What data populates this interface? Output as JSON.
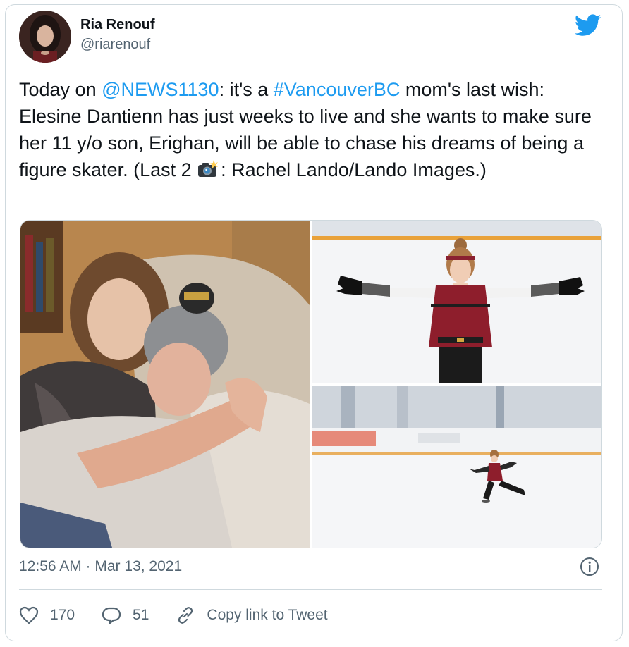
{
  "author": {
    "name": "Ria Renouf",
    "handle": "@riarenouf"
  },
  "tweet": {
    "text_1": "Today on ",
    "mention": "@NEWS1130",
    "text_2": ": it's a ",
    "hashtag": "#VancouverBC",
    "text_3": " mom's last wish: Elesine Dantienn has just weeks to live and she wants to make sure her 11 y/o son, Erighan, will be able to chase his dreams of being a figure skater. (Last 2 ",
    "camera_emoji": "camera-with-flash-icon",
    "text_4": ": Rachel Lando/Lando Images.)"
  },
  "timestamp": "12:56 AM · Mar 13, 2021",
  "actions": {
    "likes": "170",
    "replies": "51",
    "copy_link": "Copy link to Tweet"
  },
  "colors": {
    "link": "#1d9bf0",
    "secondary": "#536471",
    "border": "#cfd9de"
  }
}
